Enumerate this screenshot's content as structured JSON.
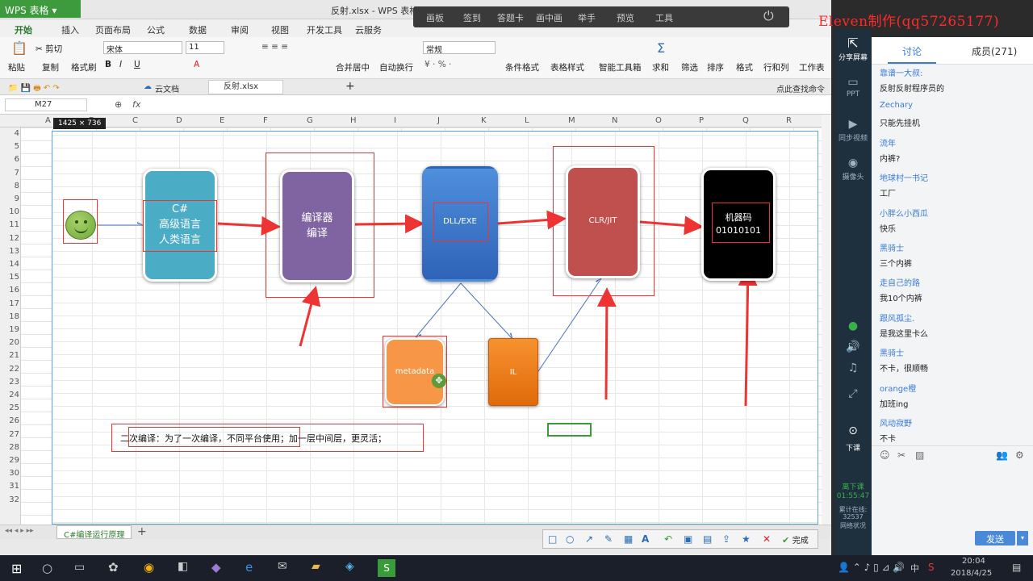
{
  "window": {
    "app_button": "WPS 表格",
    "doc_title": "反射.xlsx - WPS 表格",
    "size_label": "1425 × 736"
  },
  "floatbar": {
    "items": [
      "画板",
      "签到",
      "答题卡",
      "画中画",
      "举手",
      "预览",
      "工具"
    ]
  },
  "ribbon": {
    "tabs": [
      "开始",
      "插入",
      "页面布局",
      "公式",
      "数据",
      "审阅",
      "视图",
      "开发工具",
      "云服务"
    ],
    "clipboard": {
      "cut": "剪切",
      "paste": "粘贴",
      "copy": "复制",
      "format_painter": "格式刷"
    },
    "font_name": "宋体",
    "font_size": "11",
    "merge": "合并居中",
    "wrap": "自动换行",
    "number_format": "常规",
    "cond_format": "条件格式",
    "table_style": "表格样式",
    "smart_toolbox": "智能工具箱",
    "sum": "求和",
    "filter": "筛选",
    "sort": "排序",
    "format": "格式",
    "rowcol": "行和列",
    "sheet": "工作表"
  },
  "tabs": {
    "cloud": "云文档",
    "file": "反射.xlsx",
    "search": "点此查找命令"
  },
  "formula": {
    "namebox": "M27",
    "fx": "fx"
  },
  "columns": [
    "A",
    "B",
    "C",
    "D",
    "E",
    "F",
    "G",
    "H",
    "I",
    "J",
    "K",
    "L",
    "M",
    "N",
    "O",
    "P",
    "Q",
    "R"
  ],
  "rows": [
    "4",
    "5",
    "6",
    "7",
    "8",
    "9",
    "10",
    "11",
    "12",
    "13",
    "14",
    "15",
    "16",
    "17",
    "18",
    "19",
    "20",
    "21",
    "22",
    "23",
    "24",
    "25",
    "26",
    "27",
    "28",
    "29",
    "30",
    "31",
    "32"
  ],
  "diagram": {
    "csharp": [
      "C#",
      "高级语言",
      "人类语言"
    ],
    "compiler": [
      "编译器",
      "编译"
    ],
    "dll": "DLL/EXE",
    "clr": "CLR/JIT",
    "machine": [
      "机器码",
      "01010101"
    ],
    "metadata": "metadata",
    "il": "IL",
    "note": "二次编译：为了一次编译，不同平台使用；加一层中间层，更灵活；"
  },
  "sheet_tab": "C#编译运行原理",
  "drawbar": {
    "done": "完成"
  },
  "watermark": "Eleven制作(qq57265177)",
  "sidebar": {
    "share": "分享屏幕",
    "ppt": "PPT",
    "sync": "同步视频",
    "camera": "摄像头",
    "end_class": "下课",
    "status": "离下课",
    "time": "01:55:47",
    "duration": "累计在线:",
    "count": "32537",
    "bandwidth": "网络状况"
  },
  "panel": {
    "tabs": [
      "讨论",
      "成员(271)"
    ],
    "messages": [
      {
        "name": "靠谱一大叔:",
        "text": "反射反射程序员的"
      },
      {
        "name": "Zechary",
        "text": "只能先挂机"
      },
      {
        "name": "流年",
        "text": "内裤?"
      },
      {
        "name": "地球村一书记",
        "text": "工厂"
      },
      {
        "name": "小胖么小西瓜",
        "text": "快乐"
      },
      {
        "name": "黑骑士",
        "text": "三个内裤"
      },
      {
        "name": "走自己的路",
        "text": "我10个内裤"
      },
      {
        "name": "跟风孤尘.",
        "text": "是我这里卡么"
      },
      {
        "name": "黑骑士",
        "text": "不卡，很顺畅"
      },
      {
        "name": "orange橙",
        "text": "加班ing"
      },
      {
        "name": "风动寂野",
        "text": "不卡"
      }
    ],
    "send": "发送"
  },
  "taskbar": {
    "ime": "中",
    "time": "20:04",
    "date": "2018/4/25"
  }
}
